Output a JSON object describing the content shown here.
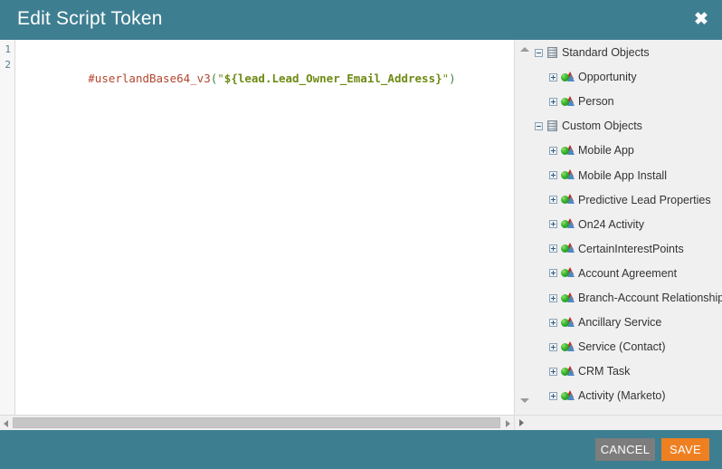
{
  "titlebar": {
    "title": "Edit Script Token",
    "close_label": "✖",
    "close_icon": "close-icon",
    "bg_color": "#3e7e91"
  },
  "editor": {
    "line_numbers": [
      "1",
      "2"
    ],
    "lines": [
      {
        "text": ""
      },
      {
        "segments": [
          {
            "kind": "fn",
            "text": "#userlandBase64_v3"
          },
          {
            "kind": "punc",
            "text": "("
          },
          {
            "kind": "str",
            "text": "\""
          },
          {
            "kind": "var",
            "text": "${lead.Lead_Owner_Email_Address}"
          },
          {
            "kind": "str",
            "text": "\""
          },
          {
            "kind": "punc",
            "text": ")"
          }
        ]
      }
    ],
    "full_code": "#userlandBase64_v3(\"${lead.Lead_Owner_Email_Address}\")",
    "hscrollbar": {
      "left_arrow_icon": "scroll-left-arrow-icon",
      "right_arrow_icon": "scroll-right-arrow-icon"
    }
  },
  "tree": {
    "scroll_up_icon": "scroll-up-arrow-icon",
    "scroll_down_icon": "scroll-down-arrow-icon",
    "scroll_right_icon": "scroll-right-arrow-icon",
    "nodes": [
      {
        "label": "Standard Objects",
        "type": "root",
        "state": "expanded",
        "icon": "database-icon",
        "indent": 0
      },
      {
        "label": "Opportunity",
        "type": "child",
        "state": "collapsed",
        "icon": "object-icon",
        "indent": 1
      },
      {
        "label": "Person",
        "type": "child",
        "state": "collapsed",
        "icon": "object-icon",
        "indent": 1
      },
      {
        "label": "Custom Objects",
        "type": "root",
        "state": "expanded",
        "icon": "database-icon",
        "indent": 0
      },
      {
        "label": "Mobile App",
        "type": "child",
        "state": "collapsed",
        "icon": "object-icon",
        "indent": 1
      },
      {
        "label": "Mobile App Install",
        "type": "child",
        "state": "collapsed",
        "icon": "object-icon",
        "indent": 1
      },
      {
        "label": "Predictive Lead Properties",
        "type": "child",
        "state": "collapsed",
        "icon": "object-icon",
        "indent": 1
      },
      {
        "label": "On24 Activity",
        "type": "child",
        "state": "collapsed",
        "icon": "object-icon",
        "indent": 1
      },
      {
        "label": "CertainInterestPoints",
        "type": "child",
        "state": "collapsed",
        "icon": "object-icon",
        "indent": 1
      },
      {
        "label": "Account Agreement",
        "type": "child",
        "state": "collapsed",
        "icon": "object-icon",
        "indent": 1
      },
      {
        "label": "Branch-Account Relationship",
        "type": "child",
        "state": "collapsed",
        "icon": "object-icon",
        "indent": 1
      },
      {
        "label": "Ancillary Service",
        "type": "child",
        "state": "collapsed",
        "icon": "object-icon",
        "indent": 1
      },
      {
        "label": "Service (Contact)",
        "type": "child",
        "state": "collapsed",
        "icon": "object-icon",
        "indent": 1
      },
      {
        "label": "CRM Task",
        "type": "child",
        "state": "collapsed",
        "icon": "object-icon",
        "indent": 1
      },
      {
        "label": "Activity (Marketo)",
        "type": "child",
        "state": "collapsed",
        "icon": "object-icon",
        "indent": 1
      }
    ]
  },
  "footer": {
    "cancel_label": "CANCEL",
    "save_label": "SAVE",
    "cancel_color": "#7d7d7d",
    "save_color": "#ef8022",
    "bg_color": "#3e7e91"
  }
}
